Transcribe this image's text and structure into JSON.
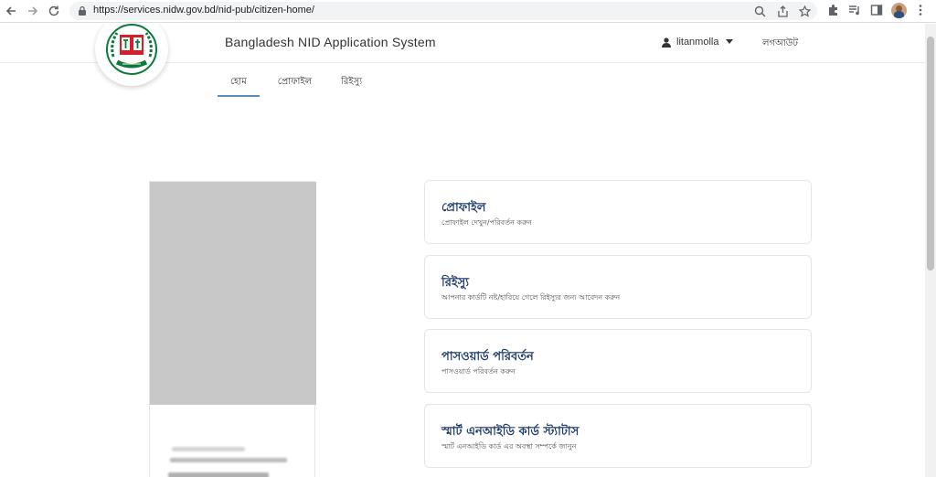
{
  "browser": {
    "url": "https://services.nidw.gov.bd/nid-pub/citizen-home/"
  },
  "header": {
    "title": "Bangladesh NID Application System",
    "username": "litanmolla",
    "logout_label": "লগআউট"
  },
  "tabs": [
    {
      "label": "হোম",
      "active": true
    },
    {
      "label": "প্রোফাইল",
      "active": false
    },
    {
      "label": "রিইস্যু",
      "active": false
    }
  ],
  "menu_cards": [
    {
      "title": "প্রোফাইল",
      "subtitle": "প্রোফাইল দেখুন/পরিবর্তন করুন"
    },
    {
      "title": "রিইস্যু",
      "subtitle": "আপনার কার্ডটি নষ্ট/হারিয়ে গেলে রিইস্যুর জন্য আবেদন করুন"
    },
    {
      "title": "পাসওয়ার্ড পরিবর্তন",
      "subtitle": "পাসওয়ার্ড পরিবর্তন করুন"
    },
    {
      "title": "স্মার্ট এনআইডি কার্ড স্ট্যাটাস",
      "subtitle": "স্মার্ট এনআইডি কার্ড এর অবস্থা সম্পর্কে জানুন"
    }
  ],
  "colors": {
    "accent": "#5b8fb9",
    "card_title": "#1f3b6e",
    "logo_green": "#0a7a3b",
    "logo_red": "#d3202a"
  },
  "icons": {
    "back": "arrow-left-icon",
    "forward": "arrow-right-icon",
    "reload": "reload-icon",
    "lock": "lock-icon",
    "user": "user-icon",
    "dropdown": "caret-down-icon"
  }
}
